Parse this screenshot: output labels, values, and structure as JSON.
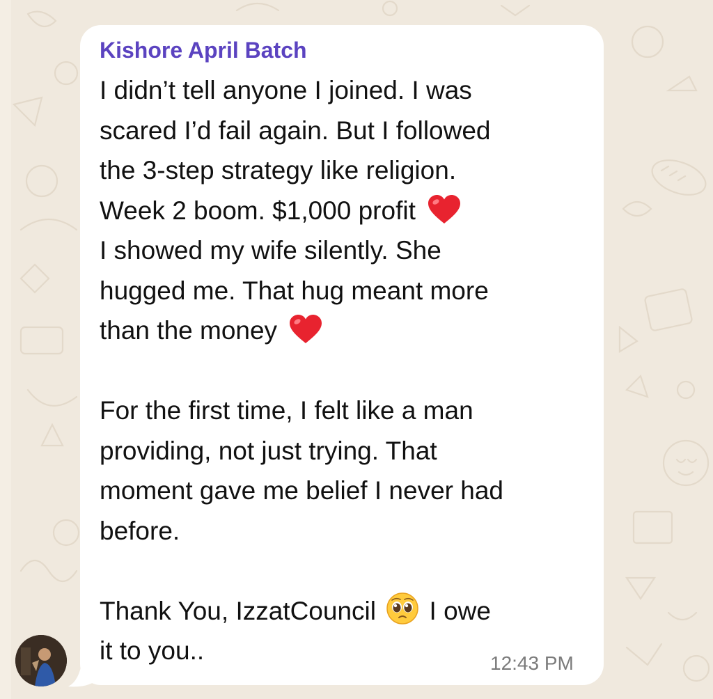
{
  "message": {
    "sender": "Kishore April Batch",
    "lines": [
      {
        "text": "I didn’t tell anyone I joined. I was",
        "emoji": null
      },
      {
        "text": "scared I’d fail again. But I followed",
        "emoji": null
      },
      {
        "text": "the 3-step strategy like religion.",
        "emoji": null
      },
      {
        "text": "Week 2 boom. $1,000 profit ",
        "emoji": "heart"
      },
      {
        "text": "I showed my wife silently. She",
        "emoji": null
      },
      {
        "text": "hugged me. That hug meant more",
        "emoji": null
      },
      {
        "text": "than the money ",
        "emoji": "heart"
      },
      {
        "text": "",
        "emoji": null
      },
      {
        "text": "For the first time, I felt like a man",
        "emoji": null
      },
      {
        "text": "providing, not just trying. That",
        "emoji": null
      },
      {
        "text": "moment gave me belief I never had",
        "emoji": null
      },
      {
        "text": "before.",
        "emoji": null
      },
      {
        "text": "",
        "emoji": null
      },
      {
        "text": "Thank You, IzzatCouncil ",
        "emoji": "pleading-face",
        "after": " I owe"
      },
      {
        "text": "it to you..",
        "emoji": null
      }
    ],
    "timestamp": "12:43 PM"
  },
  "colors": {
    "sender_name": "#5b43c0",
    "bubble": "#ffffff",
    "wallpaper": "#f0e9de",
    "text": "#111111",
    "timestamp": "#7b7b7b"
  },
  "icons": {
    "heart": "red-heart-icon",
    "pleading_face": "pleading-face-icon",
    "avatar": "user-avatar"
  }
}
